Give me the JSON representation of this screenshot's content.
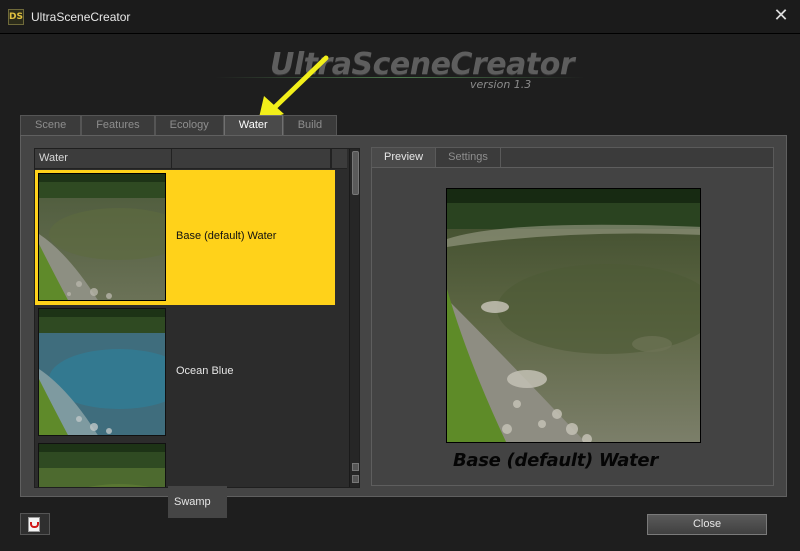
{
  "window": {
    "app_logo": "DS",
    "title": "UltraSceneCreator",
    "close_glyph": "✕"
  },
  "banner": {
    "title": "UltraSceneCreator",
    "version": "version 1.3"
  },
  "tabs": [
    {
      "label": "Scene",
      "active": false
    },
    {
      "label": "Features",
      "active": false
    },
    {
      "label": "Ecology",
      "active": false
    },
    {
      "label": "Water",
      "active": true
    },
    {
      "label": "Build",
      "active": false
    }
  ],
  "list": {
    "columns": [
      "Water",
      ""
    ],
    "items": [
      {
        "label": "Base (default) Water",
        "selected": true,
        "thumb": "pond-clear-icon"
      },
      {
        "label": "Ocean Blue",
        "selected": false,
        "thumb": "pond-blue-icon"
      },
      {
        "label": "Swamp",
        "selected": false,
        "thumb": "pond-green-icon"
      }
    ]
  },
  "preview": {
    "tabs": [
      {
        "label": "Preview",
        "active": true
      },
      {
        "label": "Settings",
        "active": false
      }
    ],
    "caption": "Base (default) Water"
  },
  "footer": {
    "close_label": "Close",
    "pdf_icon": "pdf-icon"
  },
  "colors": {
    "selection": "#ffd21a",
    "arrow": "#f2ef1a"
  }
}
